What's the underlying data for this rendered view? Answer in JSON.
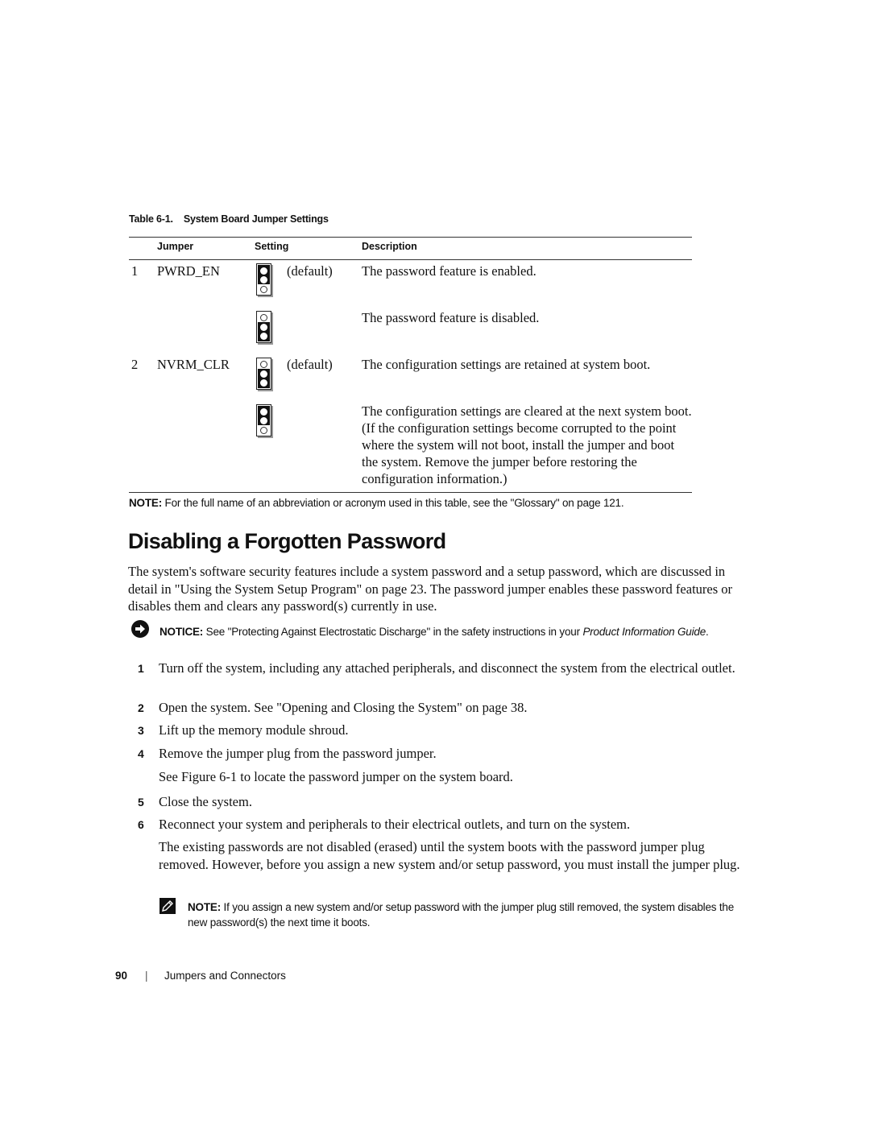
{
  "table": {
    "caption": "Table 6-1.    System Board Jumper Settings",
    "headers": {
      "jumper": "Jumper",
      "setting": "Setting",
      "description": "Description"
    },
    "rows": [
      {
        "num": "1",
        "jumper": "PWRD_EN",
        "setting_label": "(default)",
        "jumper_state": "pins-1-2-installed",
        "description": "The password feature is enabled."
      },
      {
        "num": "",
        "jumper": "",
        "setting_label": "",
        "jumper_state": "pins-2-3-installed",
        "description": "The password feature is disabled."
      },
      {
        "num": "2",
        "jumper": "NVRM_CLR",
        "setting_label": "(default)",
        "jumper_state": "pins-2-3-installed",
        "description": "The configuration settings are retained at system boot."
      },
      {
        "num": "",
        "jumper": "",
        "setting_label": "",
        "jumper_state": "pins-1-2-installed",
        "description": "The configuration settings are cleared at the next system boot. (If the configuration settings become corrupted to the point where the system will not boot, install the jumper and boot the system. Remove the jumper before restoring the configuration information.)"
      }
    ],
    "note_label": "NOTE:",
    "note_text": " For the full name of an abbreviation or acronym used in this table, see the \"Glossary\" on page 121."
  },
  "section": {
    "title": "Disabling a Forgotten Password",
    "intro": "The system's software security features include a system password and a setup password, which are discussed in detail in \"Using the System Setup Program\" on page 23. The password jumper enables these password features or disables them and clears any password(s) currently in use.",
    "notice": {
      "icon": "notice-arrow-icon",
      "label": "NOTICE:",
      "text": " See \"Protecting Against Electrostatic Discharge\" in the safety instructions in your ",
      "italic": "Product Information Guide",
      "end": "."
    },
    "steps": [
      {
        "num": "1",
        "text": "Turn off the system, including any attached peripherals, and disconnect the system from the electrical outlet."
      },
      {
        "num": "2",
        "text": "Open the system. See \"Opening and Closing the System\" on page 38."
      },
      {
        "num": "3",
        "text": "Lift up the memory module shroud."
      },
      {
        "num": "4",
        "text": "Remove the jumper plug from the password jumper.",
        "sub": "See Figure 6-1 to locate the password jumper on the system board."
      },
      {
        "num": "5",
        "text": "Close the system."
      },
      {
        "num": "6",
        "text": "Reconnect your system and peripherals to their electrical outlets, and turn on the system.",
        "sub": "The existing passwords are not disabled (erased) until the system boots with the password jumper plug removed. However, before you assign a new system and/or setup password, you must install the jumper plug."
      }
    ],
    "note": {
      "icon": "pencil-note-icon",
      "label": "NOTE:",
      "text": " If you assign a new system and/or setup password with the jumper plug still removed, the system disables the new password(s) the next time it boots."
    }
  },
  "footer": {
    "page_number": "90",
    "separator": "|",
    "chapter": "Jumpers and Connectors"
  }
}
